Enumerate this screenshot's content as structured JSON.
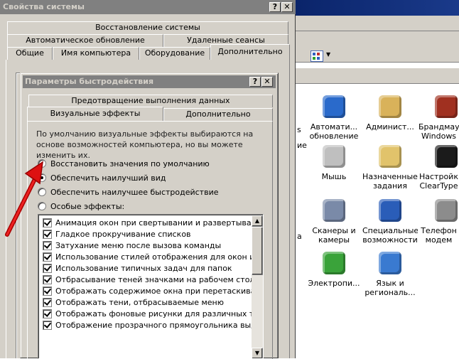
{
  "sysprops": {
    "title": "Свойства системы",
    "help_btn": "?",
    "close_btn": "✕",
    "tabs_row1": [
      "Восстановление системы"
    ],
    "tabs_row2": [
      "Автоматическое обновление",
      "Удаленные сеансы"
    ],
    "tabs_row3": [
      "Общие",
      "Имя компьютера",
      "Оборудование",
      "Дополнительно"
    ]
  },
  "perf": {
    "title": "Параметры быстродействия",
    "help_btn": "?",
    "close_btn": "✕",
    "tab_dep": "Предотвращение выполнения данных",
    "tab_visual": "Визуальные эффекты",
    "tab_advanced": "Дополнительно",
    "description": "По умолчанию визуальные эффекты выбираются на основе возможностей компьютера, но вы можете изменить их.",
    "radios": [
      {
        "label": "Восстановить значения по умолчанию",
        "checked": false
      },
      {
        "label": "Обеспечить наилучший вид",
        "checked": true
      },
      {
        "label": "Обеспечить наилучшее быстродействие",
        "checked": false
      },
      {
        "label": "Особые эффекты:",
        "checked": false
      }
    ],
    "effects": [
      "Анимация окон при свертывании и развертывании",
      "Гладкое прокручивание списков",
      "Затухание меню после вызова команды",
      "Использование стилей отображения для окон и кнопо",
      "Использование типичных задач для папок",
      "Отбрасывание теней значками на рабочем столе",
      "Отображать содержимое окна при перетаскивании",
      "Отображать тени, отбрасываемые меню",
      "Отображать фоновые рисунки для различных типов п",
      "Отображение прозрачного прямоугольника выделени"
    ]
  },
  "cpanel": {
    "items": [
      {
        "label1": "Автомати...",
        "label2": "обновление",
        "icon": "windows-update-icon"
      },
      {
        "label1": "Админист...",
        "label2": "",
        "icon": "admin-tools-icon"
      },
      {
        "label1": "Брандмауэ",
        "label2": "Windows",
        "icon": "firewall-icon"
      },
      {
        "label1": "Мышь",
        "label2": "",
        "icon": "mouse-icon"
      },
      {
        "label1": "Назначенные",
        "label2": "задания",
        "icon": "scheduled-tasks-icon"
      },
      {
        "label1": "Настройк",
        "label2": "ClearType",
        "icon": "cleartype-icon"
      },
      {
        "label1": "Сканеры и",
        "label2": "камеры",
        "icon": "scanner-camera-icon"
      },
      {
        "label1": "Специальные",
        "label2": "возможности",
        "icon": "accessibility-icon"
      },
      {
        "label1": "Телефон",
        "label2": "модем",
        "icon": "phone-modem-icon"
      },
      {
        "label1": "Электропи...",
        "label2": "",
        "icon": "power-options-icon"
      },
      {
        "label1": "Язык и",
        "label2": "региональ...",
        "icon": "regional-options-icon"
      }
    ],
    "left_edge_text": [
      "s",
      "ие",
      "а"
    ]
  },
  "colors": {
    "accent_red": "#cc0000",
    "win_bg": "#d4d0c8",
    "title_inactive": "#808080",
    "dark_blue": "#000080"
  }
}
